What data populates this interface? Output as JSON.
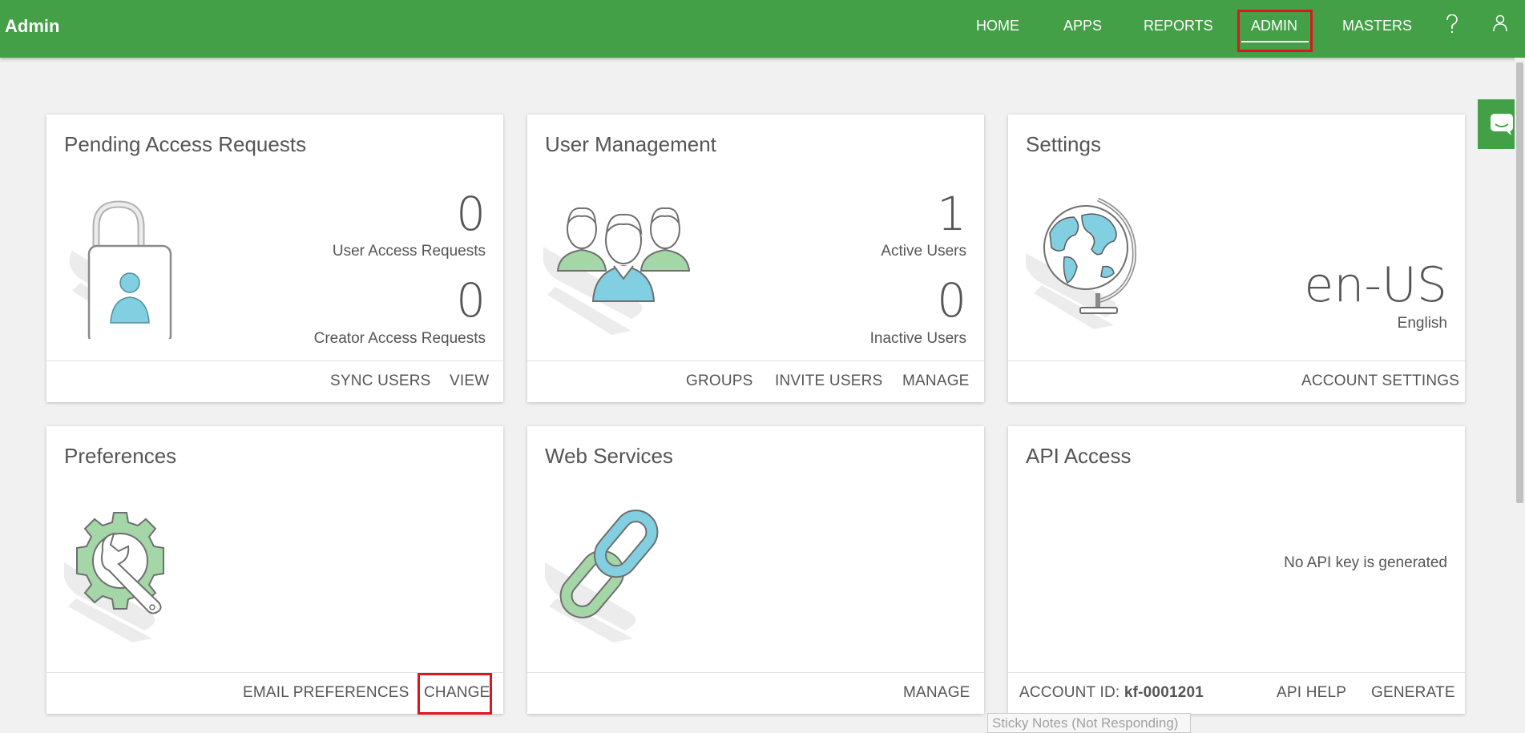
{
  "header": {
    "title": "Admin",
    "nav": [
      {
        "label": "HOME"
      },
      {
        "label": "APPS"
      },
      {
        "label": "REPORTS"
      },
      {
        "label": "ADMIN"
      },
      {
        "label": "MASTERS"
      }
    ],
    "help_icon": "question-icon",
    "user_icon": "user-icon"
  },
  "chat_widget_icon": "chat-bubble-icon",
  "cards": {
    "pending": {
      "title": "Pending Access Requests",
      "icon": "padlock-user-icon",
      "user_access_count": "0",
      "user_access_label": "User Access Requests",
      "creator_access_count": "0",
      "creator_access_label": "Creator Access Requests",
      "actions": [
        "SYNC USERS",
        "VIEW"
      ]
    },
    "users": {
      "title": "User Management",
      "icon": "user-group-icon",
      "active_count": "1",
      "active_label": "Active Users",
      "inactive_count": "0",
      "inactive_label": "Inactive Users",
      "actions": [
        "GROUPS",
        "INVITE USERS",
        "MANAGE"
      ]
    },
    "settings": {
      "title": "Settings",
      "icon": "globe-icon",
      "locale": "en-US",
      "language": "English",
      "actions": [
        "ACCOUNT SETTINGS"
      ]
    },
    "preferences": {
      "title": "Preferences",
      "icon": "gear-wrench-icon",
      "actions": [
        "EMAIL PREFERENCES",
        "CHANGE"
      ]
    },
    "web_services": {
      "title": "Web Services",
      "icon": "chain-link-icon",
      "actions": [
        "MANAGE"
      ]
    },
    "api": {
      "title": "API Access",
      "message": "No API key is generated",
      "account_id_label": "ACCOUNT ID:",
      "account_id_value": "kf-0001201",
      "actions": [
        "API HELP",
        "GENERATE"
      ]
    }
  },
  "taskbar_tooltip": "Sticky Notes (Not Responding)",
  "colors": {
    "header": "#43a047",
    "highlight": "#e1141e",
    "icon_green": "#a5d6a7",
    "icon_blue": "#81cfe0"
  }
}
